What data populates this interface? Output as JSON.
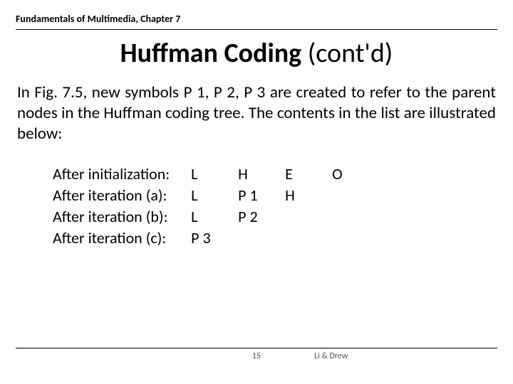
{
  "header": {
    "chapter": "Fundamentals of Multimedia, Chapter 7"
  },
  "title": {
    "main": "Huffman Coding",
    "suffix": " (cont'd)"
  },
  "paragraph": "In Fig. 7.5, new symbols P 1, P 2, P 3 are created to refer to the parent nodes in the Huffman coding tree. The contents in the list are illustrated below:",
  "rows": {
    "labels": [
      "After initialization:",
      "After iteration (a):",
      "After iteration (b):",
      "After iteration (c):"
    ],
    "cells": [
      [
        "L",
        "H",
        "E",
        "O"
      ],
      [
        "L",
        "P 1",
        "H",
        ""
      ],
      [
        "L",
        "P 2",
        "",
        ""
      ],
      [
        "P 3",
        "",
        "",
        ""
      ]
    ]
  },
  "footer": {
    "page": "15",
    "authors": "Li & Drew"
  }
}
